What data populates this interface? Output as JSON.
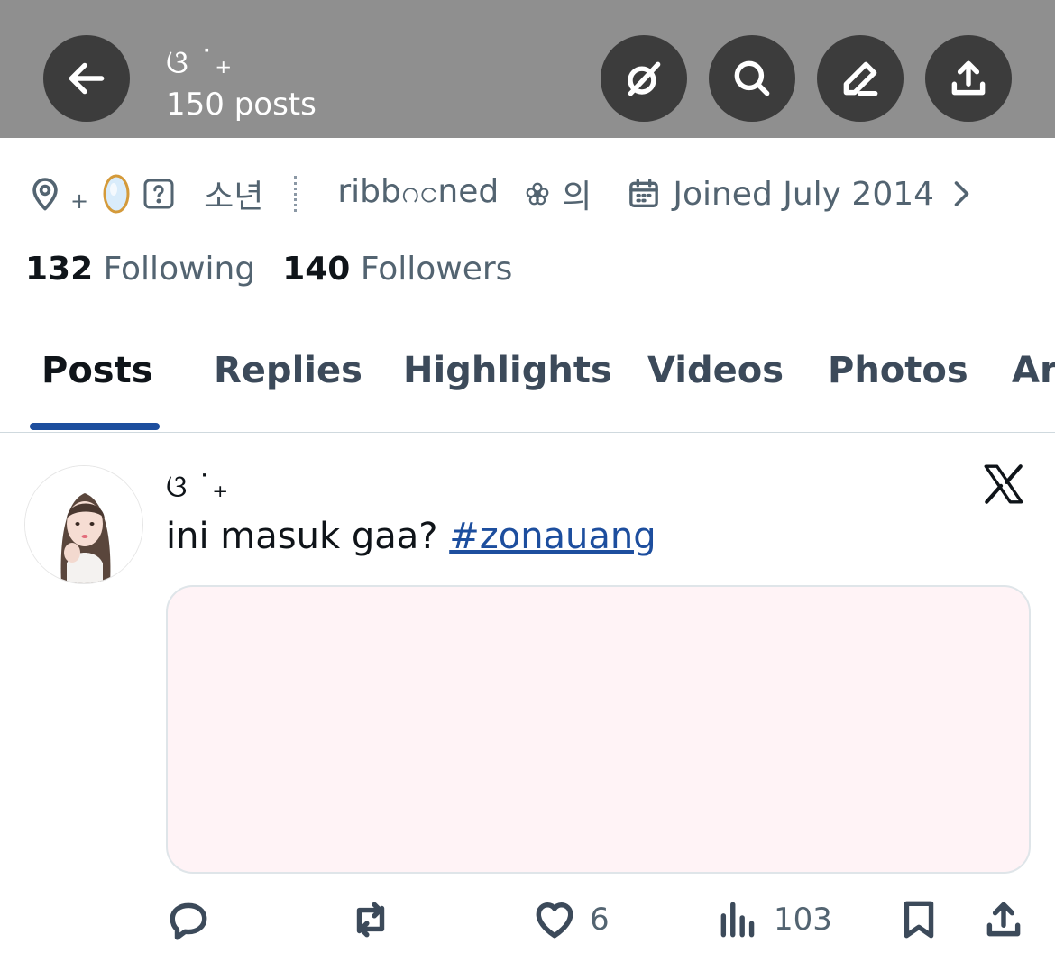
{
  "header": {
    "display_name": "ଓ ˙₊",
    "posts_count": "150 posts",
    "back_label": "Back",
    "grok_label": "Grok",
    "search_label": "Search",
    "edit_label": "Edit",
    "share_label": "Share"
  },
  "meta": {
    "location_plus": "+",
    "location_text": "소년",
    "website_text": "ribbဂငned",
    "website_suffix": "의",
    "joined": "Joined July 2014"
  },
  "follow": {
    "following_count": "132",
    "following_label": "Following",
    "followers_count": "140",
    "followers_label": "Followers"
  },
  "tabs": [
    "Posts",
    "Replies",
    "Highlights",
    "Videos",
    "Photos",
    "Ar"
  ],
  "post": {
    "author_name": "ଓ ˙₊",
    "text": "ini masuk gaa? ",
    "hashtag": "#zonauang",
    "media_color": "#fff3f6",
    "likes": "6",
    "views": "103"
  },
  "icons": [
    "arrow-left-icon",
    "grok-icon",
    "search-icon",
    "edit-icon",
    "share-icon",
    "location-pin-icon",
    "mirror-icon",
    "question-icon",
    "flower-icon",
    "calendar-icon",
    "chevron-right-icon",
    "x-logo-icon",
    "reply-icon",
    "retweet-icon",
    "heart-icon",
    "views-icon",
    "bookmark-icon",
    "share-icon"
  ],
  "colors": {
    "header_bg": "#8f8f8f",
    "link": "#1d4e9e",
    "text_secondary": "#536471"
  }
}
